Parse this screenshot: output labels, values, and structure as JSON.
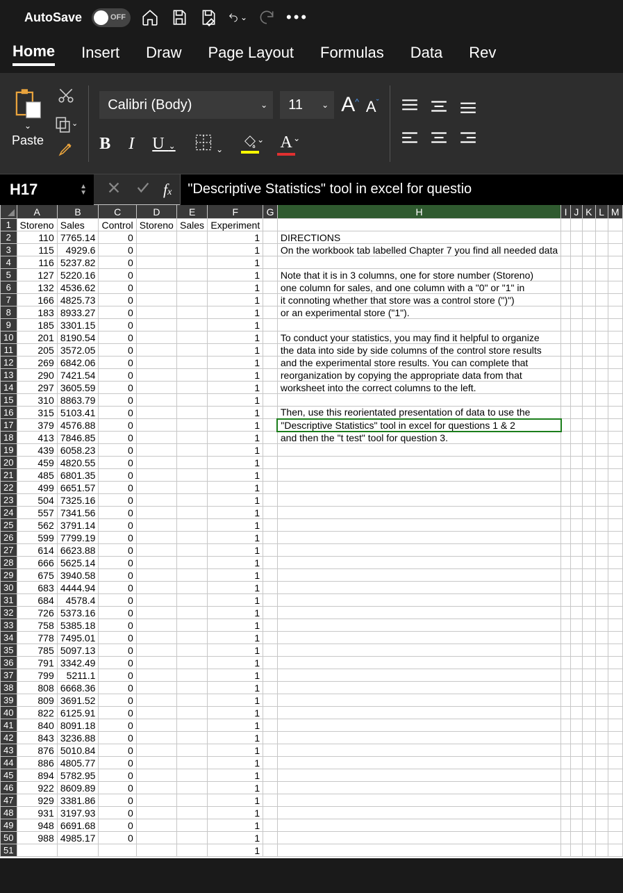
{
  "titlebar": {
    "autosave": "AutoSave",
    "autosave_state": "OFF"
  },
  "tabs": [
    "Home",
    "Insert",
    "Draw",
    "Page Layout",
    "Formulas",
    "Data",
    "Rev"
  ],
  "active_tab": 0,
  "ribbon": {
    "paste": "Paste",
    "font_name": "Calibri (Body)",
    "font_size": "11"
  },
  "namebox": "H17",
  "formula": "\"Descriptive Statistics\" tool in excel for questio",
  "col_headers": [
    "A",
    "B",
    "C",
    "D",
    "E",
    "F",
    "G",
    "H",
    "I",
    "J",
    "K",
    "L",
    "M"
  ],
  "selected_col": "H",
  "selected_row": 17,
  "row1": {
    "A": "Storeno",
    "B": "Sales",
    "C": "Control",
    "D": "Storeno",
    "E": "Sales",
    "F": "Experiment"
  },
  "directions": {
    "2": "DIRECTIONS",
    "3": "On the workbook  tab labelled Chapter 7 you find all needed data",
    "5": "Note that it is in 3 columns, one  for store number (Storeno)",
    "6": "one column for sales, and one column with a \"0\" or \"1\" in",
    "7": "it connoting whether that store was a control store (\")\")",
    "8": "or an experimental store (\"1\").",
    "10": "To conduct your statistics, you may find it helpful  to organize",
    "11": "the data into side by side columns of the control store results",
    "12": "and the experimental store results.  You can complete that",
    "13": "reorganization by copying the appropriate data from that",
    "14": "worksheet into the correct columns to the left.",
    "16": "Then, use this reorientated presentation of data to use the",
    "17": "\"Descriptive Statistics\" tool in excel for questions 1 & 2",
    "18": "and then the \"t test\" tool for question 3."
  },
  "rows": [
    [
      110,
      7765.14,
      0,
      "",
      "",
      1
    ],
    [
      115,
      4929.6,
      0,
      "",
      "",
      1
    ],
    [
      116,
      5237.82,
      0,
      "",
      "",
      1
    ],
    [
      127,
      5220.16,
      0,
      "",
      "",
      1
    ],
    [
      132,
      4536.62,
      0,
      "",
      "",
      1
    ],
    [
      166,
      4825.73,
      0,
      "",
      "",
      1
    ],
    [
      183,
      8933.27,
      0,
      "",
      "",
      1
    ],
    [
      185,
      3301.15,
      0,
      "",
      "",
      1
    ],
    [
      201,
      8190.54,
      0,
      "",
      "",
      1
    ],
    [
      205,
      3572.05,
      0,
      "",
      "",
      1
    ],
    [
      269,
      6842.06,
      0,
      "",
      "",
      1
    ],
    [
      290,
      7421.54,
      0,
      "",
      "",
      1
    ],
    [
      297,
      3605.59,
      0,
      "",
      "",
      1
    ],
    [
      310,
      8863.79,
      0,
      "",
      "",
      1
    ],
    [
      315,
      5103.41,
      0,
      "",
      "",
      1
    ],
    [
      379,
      4576.88,
      0,
      "",
      "",
      1
    ],
    [
      413,
      7846.85,
      0,
      "",
      "",
      1
    ],
    [
      439,
      6058.23,
      0,
      "",
      "",
      1
    ],
    [
      459,
      4820.55,
      0,
      "",
      "",
      1
    ],
    [
      485,
      6801.35,
      0,
      "",
      "",
      1
    ],
    [
      499,
      6651.57,
      0,
      "",
      "",
      1
    ],
    [
      504,
      7325.16,
      0,
      "",
      "",
      1
    ],
    [
      557,
      7341.56,
      0,
      "",
      "",
      1
    ],
    [
      562,
      3791.14,
      0,
      "",
      "",
      1
    ],
    [
      599,
      7799.19,
      0,
      "",
      "",
      1
    ],
    [
      614,
      6623.88,
      0,
      "",
      "",
      1
    ],
    [
      666,
      5625.14,
      0,
      "",
      "",
      1
    ],
    [
      675,
      3940.58,
      0,
      "",
      "",
      1
    ],
    [
      683,
      4444.94,
      0,
      "",
      "",
      1
    ],
    [
      684,
      4578.4,
      0,
      "",
      "",
      1
    ],
    [
      726,
      5373.16,
      0,
      "",
      "",
      1
    ],
    [
      758,
      5385.18,
      0,
      "",
      "",
      1
    ],
    [
      778,
      7495.01,
      0,
      "",
      "",
      1
    ],
    [
      785,
      5097.13,
      0,
      "",
      "",
      1
    ],
    [
      791,
      3342.49,
      0,
      "",
      "",
      1
    ],
    [
      799,
      5211.1,
      0,
      "",
      "",
      1
    ],
    [
      808,
      6668.36,
      0,
      "",
      "",
      1
    ],
    [
      809,
      3691.52,
      0,
      "",
      "",
      1
    ],
    [
      822,
      6125.91,
      0,
      "",
      "",
      1
    ],
    [
      840,
      8091.18,
      0,
      "",
      "",
      1
    ],
    [
      843,
      3236.88,
      0,
      "",
      "",
      1
    ],
    [
      876,
      5010.84,
      0,
      "",
      "",
      1
    ],
    [
      886,
      4805.77,
      0,
      "",
      "",
      1
    ],
    [
      894,
      5782.95,
      0,
      "",
      "",
      1
    ],
    [
      922,
      8609.89,
      0,
      "",
      "",
      1
    ],
    [
      929,
      3381.86,
      0,
      "",
      "",
      1
    ],
    [
      931,
      3197.93,
      0,
      "",
      "",
      1
    ],
    [
      948,
      6691.68,
      0,
      "",
      "",
      1
    ],
    [
      988,
      4985.17,
      0,
      "",
      "",
      1
    ],
    [
      "",
      "",
      "",
      "",
      "",
      1
    ]
  ]
}
